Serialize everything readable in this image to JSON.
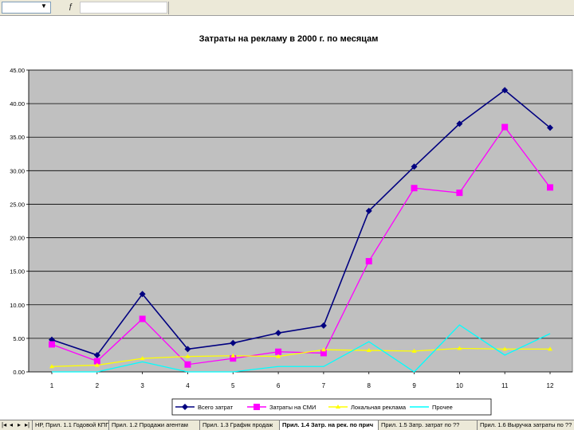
{
  "tabs": {
    "nav": [
      "|◂",
      "◂",
      "▸",
      "▸|"
    ],
    "items": [
      {
        "label": "НР, Прил. 1.1 Годовой КПГ",
        "active": false
      },
      {
        "label": "Прил. 1.2 Продажи агентам",
        "active": false
      },
      {
        "label": "Прил. 1.3 График продаж",
        "active": false
      },
      {
        "label": "Прил. 1.4 Затр. на рек. по прич",
        "active": true
      },
      {
        "label": "Прил. 1.5 Затр. затрат по ??",
        "active": false
      },
      {
        "label": "Прил. 1.6 Выручка затраты по ??",
        "active": false
      }
    ]
  },
  "chart_data": {
    "type": "line",
    "title": "Затраты на рекламу в 2000 г. по месяцам",
    "xlabel": "",
    "ylabel": "",
    "categories": [
      "1",
      "2",
      "3",
      "4",
      "5",
      "6",
      "7",
      "8",
      "9",
      "10",
      "11",
      "12"
    ],
    "ylim": [
      0,
      45
    ],
    "yticks": [
      "0.00",
      "5.00",
      "10.00",
      "15.00",
      "20.00",
      "25.00",
      "30.00",
      "35.00",
      "40.00",
      "45.00"
    ],
    "grid": true,
    "plot_background": "#c0c0c0",
    "legend_position": "bottom",
    "series": [
      {
        "name": "Всего затрат",
        "color": "#000080",
        "marker": "diamond",
        "values": [
          4.8,
          2.5,
          11.6,
          3.4,
          4.3,
          5.8,
          6.9,
          24.0,
          30.6,
          37.0,
          42.0,
          36.4
        ]
      },
      {
        "name": "Затраты на СМИ",
        "color": "#ff00ff",
        "marker": "square",
        "values": [
          4.1,
          1.6,
          7.9,
          1.1,
          2.0,
          3.0,
          2.8,
          16.5,
          27.4,
          26.7,
          36.5,
          27.5
        ]
      },
      {
        "name": "Локальная реклама",
        "color": "#ffff00",
        "marker": "triangle",
        "values": [
          0.8,
          1.0,
          2.0,
          2.3,
          2.4,
          2.3,
          3.3,
          3.2,
          3.1,
          3.5,
          3.4,
          3.4
        ]
      },
      {
        "name": "Прочее",
        "color": "#00ffff",
        "marker": "none",
        "values": [
          0.0,
          0.0,
          1.5,
          0.0,
          0.0,
          0.8,
          0.8,
          4.5,
          0.0,
          7.0,
          2.5,
          5.7
        ]
      }
    ]
  }
}
